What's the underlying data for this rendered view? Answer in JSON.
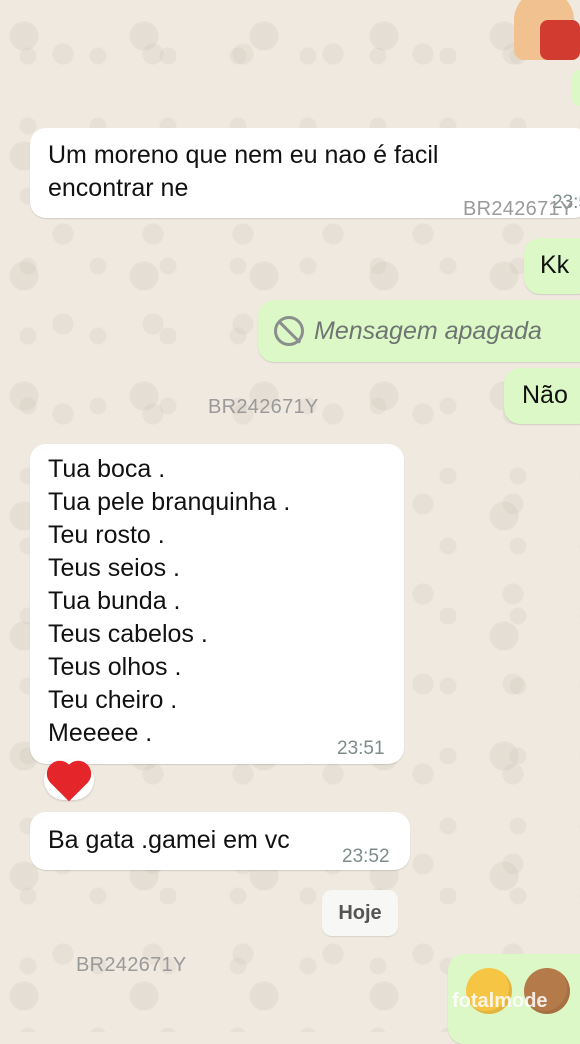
{
  "messages": [
    {
      "id": "m1",
      "direction": "in",
      "text": "Um moreno que nem eu nao é facil encontrar ne",
      "time": "23:5"
    },
    {
      "id": "m2",
      "direction": "out",
      "text": "Kk"
    },
    {
      "id": "m3",
      "direction": "out",
      "text": "Mensagem apagada",
      "deleted": true
    },
    {
      "id": "m4",
      "direction": "out",
      "text": "Não"
    },
    {
      "id": "m5",
      "direction": "in",
      "lines": [
        "Tua boca .",
        "Tua pele branquinha .",
        "Teu rosto .",
        "Teus seios .",
        "Tua bunda .",
        "Teus cabelos .",
        "Teus olhos .",
        "Teu cheiro .",
        "Meeeee ."
      ],
      "time": "23:51",
      "reaction": "red-heart"
    },
    {
      "id": "m6",
      "direction": "in",
      "text": "Ba gata .gamei em vc",
      "time": "23:52"
    }
  ],
  "date_chip": "Hoje",
  "watermarks": [
    "BR242671Y",
    "BR242671Y",
    "BR242671Y"
  ],
  "site_watermark": "fotalmode",
  "colors": {
    "incoming": "#ffffff",
    "outgoing": "#dcf8c6",
    "background": "#efe9e0",
    "heart": "#e4262b"
  }
}
